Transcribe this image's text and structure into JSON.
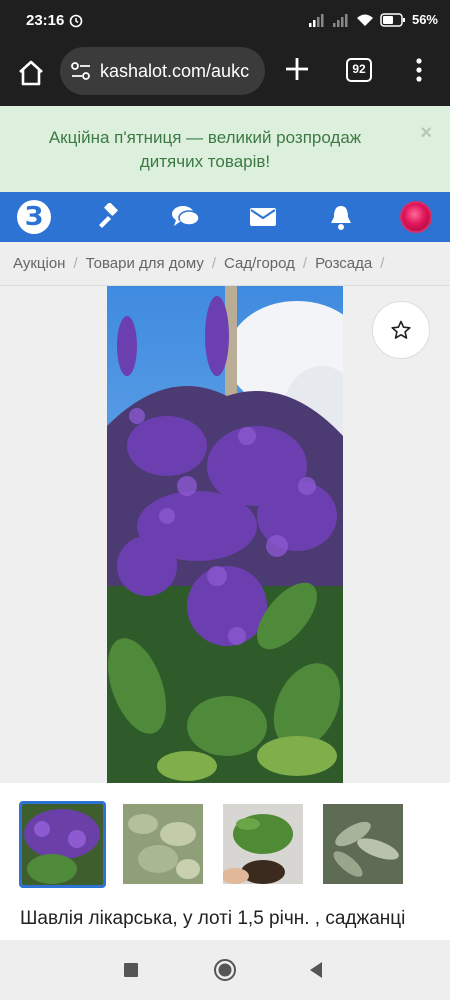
{
  "status_bar": {
    "time": "23:16",
    "battery": "56%",
    "icons": [
      "alarm-icon",
      "signal-icon",
      "signal-icon",
      "wifi-icon",
      "battery-icon"
    ]
  },
  "browser": {
    "url": "kashalot.com/aukc",
    "tab_count": "92"
  },
  "promo": {
    "text": "Акційна п'ятниця — великий розпродаж дитячих товарів!",
    "close": "×"
  },
  "nav": {
    "logo_letter": "З",
    "icons": [
      "gavel-icon",
      "chat-icon",
      "mail-icon",
      "bell-icon",
      "avatar"
    ]
  },
  "breadcrumb": [
    "Аукціон",
    "Товари для дому",
    "Сад/город",
    "Розсада"
  ],
  "listing": {
    "title": "Шавлія лікарська, у лоті 1,5 річн. , саджанці"
  },
  "colors": {
    "nav_blue": "#2d73d3",
    "promo_bg": "#dcf0dd",
    "promo_text": "#3d7a44"
  }
}
